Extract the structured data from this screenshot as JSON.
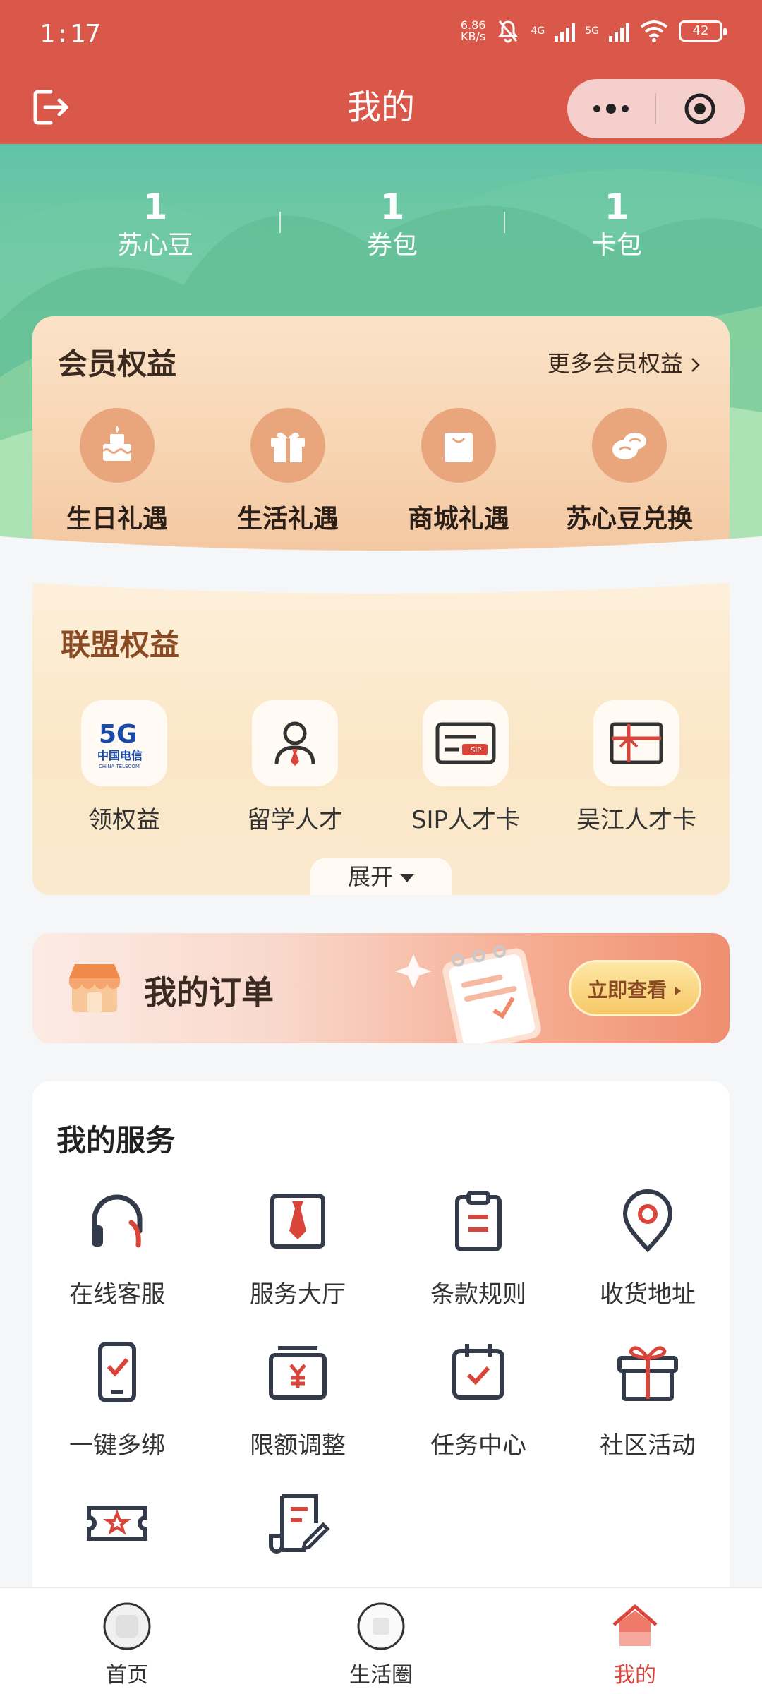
{
  "status_bar": {
    "time": "1:17",
    "net_speed_value": "6.86",
    "net_speed_unit": "KB/s",
    "network_4g": "4G",
    "network_5g": "5G",
    "battery": "42"
  },
  "header": {
    "title": "我的"
  },
  "stats": [
    {
      "value": "1",
      "label": "苏心豆"
    },
    {
      "value": "1",
      "label": "券包"
    },
    {
      "value": "1",
      "label": "卡包"
    }
  ],
  "member": {
    "title": "会员权益",
    "more_label": "更多会员权益",
    "items": [
      {
        "label": "生日礼遇",
        "icon": "birthday-cake-icon"
      },
      {
        "label": "生活礼遇",
        "icon": "gift-box-icon"
      },
      {
        "label": "商城礼遇",
        "icon": "shopping-bag-icon"
      },
      {
        "label": "苏心豆兑换",
        "icon": "bean-icon"
      }
    ]
  },
  "alliance": {
    "title": "联盟权益",
    "expand_label": "展开",
    "items": [
      {
        "label": "领权益",
        "icon": "china-telecom-5g-logo",
        "logo_5g": "5G",
        "logo_cn": "中国电信",
        "logo_en": "CHINA TELECOM"
      },
      {
        "label": "留学人才",
        "icon": "person-icon"
      },
      {
        "label": "SIP人才卡",
        "icon": "sip-card-icon",
        "card_text": "SIP"
      },
      {
        "label": "吴江人才卡",
        "icon": "red-ribbon-card-icon"
      }
    ]
  },
  "orders": {
    "title": "我的订单",
    "button_label": "立即查看"
  },
  "services": {
    "title": "我的服务",
    "items": [
      {
        "label": "在线客服",
        "icon": "headset-icon"
      },
      {
        "label": "服务大厅",
        "icon": "tie-icon"
      },
      {
        "label": "条款规则",
        "icon": "clipboard-icon"
      },
      {
        "label": "收货地址",
        "icon": "location-pin-icon"
      },
      {
        "label": "一键多绑",
        "icon": "phone-check-icon"
      },
      {
        "label": "限额调整",
        "icon": "yuan-wallet-icon"
      },
      {
        "label": "任务中心",
        "icon": "calendar-check-icon"
      },
      {
        "label": "社区活动",
        "icon": "gift-icon"
      },
      {
        "label": "",
        "icon": "star-ticket-icon"
      },
      {
        "label": "",
        "icon": "edit-document-icon"
      }
    ]
  },
  "bottom_nav": [
    {
      "label": "首页",
      "icon": "home-avatar-icon",
      "active": false
    },
    {
      "label": "生活圈",
      "icon": "life-circle-icon",
      "active": false
    },
    {
      "label": "我的",
      "icon": "my-house-icon",
      "active": true
    }
  ],
  "colors": {
    "brand_red": "#d9584a",
    "active_nav": "#d9453a",
    "hero_green": "#7fcfa0"
  }
}
